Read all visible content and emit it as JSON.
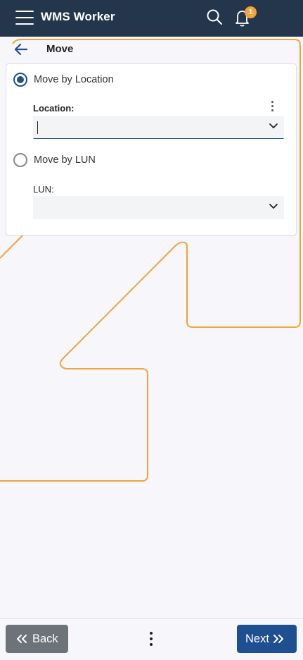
{
  "header": {
    "app_title": "WMS Worker",
    "notification_count": "1",
    "icons": [
      "menu-icon",
      "search-icon",
      "bell-icon"
    ]
  },
  "page": {
    "title": "Move"
  },
  "options": [
    {
      "label": "Move by Location",
      "selected": true,
      "field_label": "Location:",
      "value": ""
    },
    {
      "label": "Move by LUN",
      "selected": false,
      "field_label": "LUN:",
      "value": ""
    }
  ],
  "footer": {
    "back_label": "Back",
    "next_label": "Next"
  },
  "colors": {
    "header_bg": "#24364b",
    "accent": "#1d4f91",
    "badge": "#f0a43a",
    "outline": "#f0a43a",
    "back_button": "#6d7379"
  }
}
